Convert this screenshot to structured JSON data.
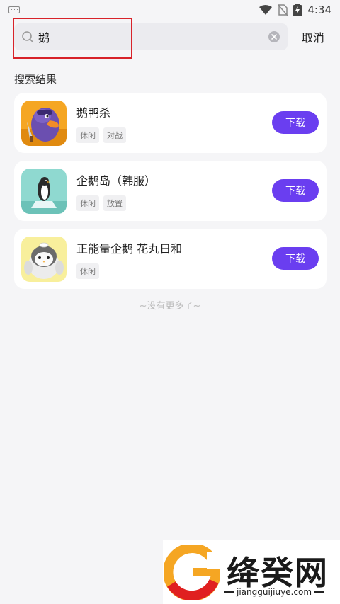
{
  "status_bar": {
    "time": "4:34",
    "icons": [
      "keyboard-icon",
      "wifi-icon",
      "no-sim-icon",
      "battery-charging-icon"
    ]
  },
  "search": {
    "query": "鹅",
    "cancel_label": "取消",
    "icons": [
      "search-icon",
      "clear-icon"
    ]
  },
  "results": {
    "section_title": "搜索结果",
    "items": [
      {
        "name": "鹅鸭杀",
        "tags": [
          "休闲",
          "对战"
        ],
        "download_label": "下载"
      },
      {
        "name": "企鹅岛（韩服）",
        "tags": [
          "休闲",
          "放置"
        ],
        "download_label": "下载"
      },
      {
        "name": "正能量企鹅 花丸日和",
        "tags": [
          "休闲"
        ],
        "download_label": "下载"
      }
    ],
    "no_more": "~没有更多了~"
  },
  "watermark": {
    "brand": "绛癸网",
    "domain": "jiangguijiuye.com"
  },
  "colors": {
    "accent": "#6a3ef0",
    "highlight": "#d8232a",
    "background": "#f5f5f7"
  }
}
